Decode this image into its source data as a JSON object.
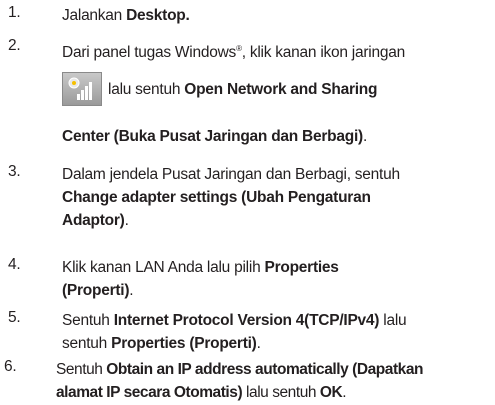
{
  "steps": [
    {
      "num": "1.",
      "a": "Jalankan ",
      "b": "Desktop."
    },
    {
      "num": "2.",
      "a": "Dari panel tugas Windows",
      "sup": "®",
      "c": ", klik kanan ikon jaringan",
      "d": "lalu sentuh ",
      "e": "Open Network and Sharing",
      "f": "Center (Buka Pusat Jaringan dan Berbagi)",
      "g": "."
    },
    {
      "num": "3.",
      "a": "Dalam jendela Pusat Jaringan dan Berbagi, sentuh",
      "b": "Change adapter settings (Ubah Pengaturan",
      "c": "Adaptor)",
      "d": "."
    },
    {
      "num": "4.",
      "a": "Klik kanan LAN Anda lalu pilih ",
      "b": "Properties",
      "c": "(Properti)",
      "d": "."
    },
    {
      "num": "5.",
      "a": "Sentuh ",
      "b": "Internet Protocol Version 4(TCP/IPv4)",
      "c": " lalu",
      "d": "sentuh ",
      "e": "Properties (Properti)",
      "f": "."
    },
    {
      "num": "6.",
      "a": "Sentuh ",
      "b": "Obtain an IP address automatically (Dapatkan",
      "c": "alamat IP secara Otomatis)",
      "d": " lalu sentuh ",
      "e": "OK",
      "f": "."
    }
  ],
  "icon": "network-signal-icon"
}
